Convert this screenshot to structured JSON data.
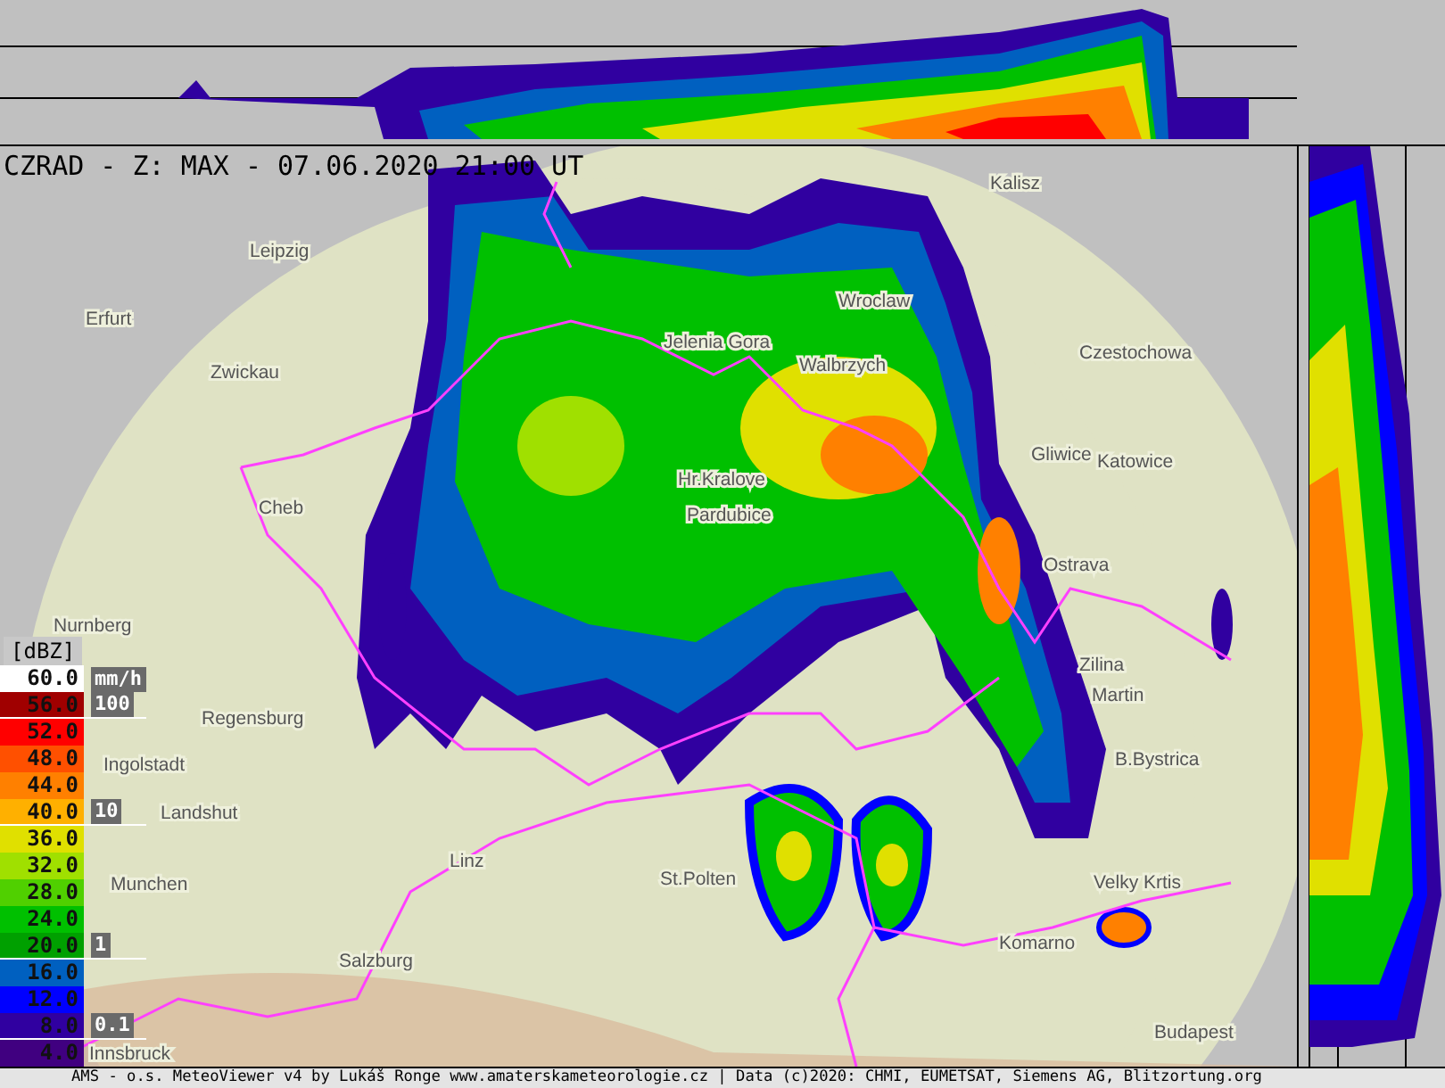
{
  "title": "CZRAD - Z: MAX - 07.06.2020 21:00 UT",
  "legend": {
    "unit": "[dBZ]",
    "rate_unit": "mm/h",
    "entries": [
      {
        "label": "60.0",
        "color": "#ffffff"
      },
      {
        "label": "56.0",
        "color": "#a00000",
        "rate_mark": "100"
      },
      {
        "label": "52.0",
        "color": "#ff0000"
      },
      {
        "label": "48.0",
        "color": "#ff5000"
      },
      {
        "label": "44.0",
        "color": "#ff8000"
      },
      {
        "label": "40.0",
        "color": "#ffb000",
        "rate_mark": "10"
      },
      {
        "label": "36.0",
        "color": "#e0e000"
      },
      {
        "label": "32.0",
        "color": "#a0e000"
      },
      {
        "label": "28.0",
        "color": "#50d000"
      },
      {
        "label": "24.0",
        "color": "#00c000"
      },
      {
        "label": "20.0",
        "color": "#00a000",
        "rate_mark": "1"
      },
      {
        "label": "16.0",
        "color": "#0060c0"
      },
      {
        "label": "12.0",
        "color": "#0000ff"
      },
      {
        "label": "8.0",
        "color": "#3000a0",
        "rate_mark": "0.1"
      },
      {
        "label": "4.0",
        "color": "#400080"
      }
    ]
  },
  "cities": [
    {
      "name": "Kalisz"
    },
    {
      "name": "Leipzig"
    },
    {
      "name": "Erfurt"
    },
    {
      "name": "Zwickau"
    },
    {
      "name": "Wroclaw"
    },
    {
      "name": "Jelenia Gora"
    },
    {
      "name": "Walbrzych"
    },
    {
      "name": "Czestochowa"
    },
    {
      "name": "Gliwice"
    },
    {
      "name": "Katowice"
    },
    {
      "name": "Hr.Kralove"
    },
    {
      "name": "Cheb"
    },
    {
      "name": "Pardubice"
    },
    {
      "name": "Ostrava"
    },
    {
      "name": "Nurnberg"
    },
    {
      "name": "Regensburg"
    },
    {
      "name": "Zilina"
    },
    {
      "name": "Martin"
    },
    {
      "name": "Ingolstadt"
    },
    {
      "name": "B.Bystrica"
    },
    {
      "name": "Landshut"
    },
    {
      "name": "Munchen"
    },
    {
      "name": "Linz"
    },
    {
      "name": "St.Polten"
    },
    {
      "name": "Velky Krtis"
    },
    {
      "name": "Salzburg"
    },
    {
      "name": "Komarno"
    },
    {
      "name": "Budapest"
    },
    {
      "name": "Innsbruck"
    }
  ],
  "footer": "AMS - o.s. MeteoViewer v4 by Lukáš Ronge www.amaterskameteorologie.cz | Data (c)2020: CHMI, EUMETSAT, Siemens AG, Blitzortung.org"
}
